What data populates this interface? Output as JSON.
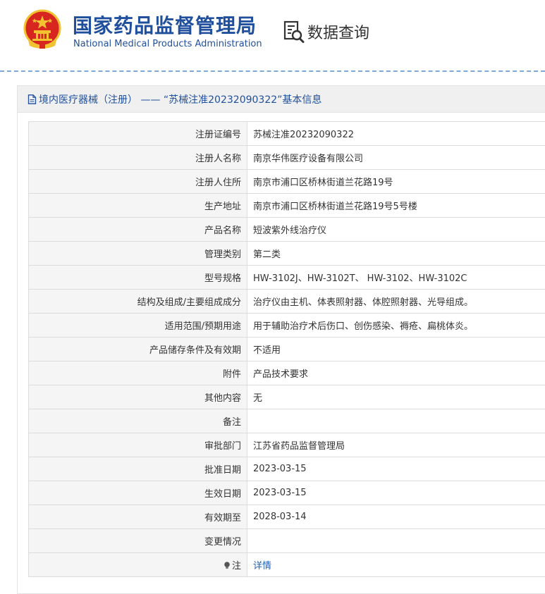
{
  "header": {
    "title_cn": "国家药品监督管理局",
    "title_en": "National Medical Products Administration",
    "query_label": "数据查询"
  },
  "panel": {
    "title": "境内医疗器械（注册） —— “苏械注准20232090322”基本信息"
  },
  "rows": [
    {
      "key": "注册证编号",
      "value": "苏械注准20232090322"
    },
    {
      "key": "注册人名称",
      "value": "南京华伟医疗设备有限公司"
    },
    {
      "key": "注册人住所",
      "value": "南京市浦口区桥林街道兰花路19号"
    },
    {
      "key": "生产地址",
      "value": "南京市浦口区桥林街道兰花路19号5号楼"
    },
    {
      "key": "产品名称",
      "value": "短波紫外线治疗仪"
    },
    {
      "key": "管理类别",
      "value": "第二类"
    },
    {
      "key": "型号规格",
      "value": "HW-3102J、HW-3102T、 HW-3102、HW-3102C"
    },
    {
      "key": "结构及组成/主要组成成分",
      "value": "治疗仪由主机、体表照射器、体腔照射器、光导组成。"
    },
    {
      "key": "适用范围/预期用途",
      "value": "用于辅助治疗术后伤口、创伤感染、褥疮、扁桃体炎。"
    },
    {
      "key": "产品储存条件及有效期",
      "value": "不适用"
    },
    {
      "key": "附件",
      "value": "产品技术要求"
    },
    {
      "key": "其他内容",
      "value": "无"
    },
    {
      "key": "备注",
      "value": ""
    },
    {
      "key": "审批部门",
      "value": "江苏省药品监督管理局"
    },
    {
      "key": "批准日期",
      "value": "2023-03-15"
    },
    {
      "key": "生效日期",
      "value": "2023-03-15"
    },
    {
      "key": "有效期至",
      "value": "2028-03-14"
    },
    {
      "key": "变更情况",
      "value": ""
    },
    {
      "key": "注",
      "value": "详情"
    }
  ],
  "icons": {
    "emblem": "national-emblem-icon",
    "query": "search-document-icon",
    "panel": "document-icon",
    "note": "lightbulb-icon"
  },
  "colors": {
    "brand_blue": "#1f4f9d",
    "link_blue": "#1f62b5",
    "label_bg": "#f5f5f5",
    "emblem_red": "#d6261f",
    "emblem_gold": "#f2c230"
  }
}
